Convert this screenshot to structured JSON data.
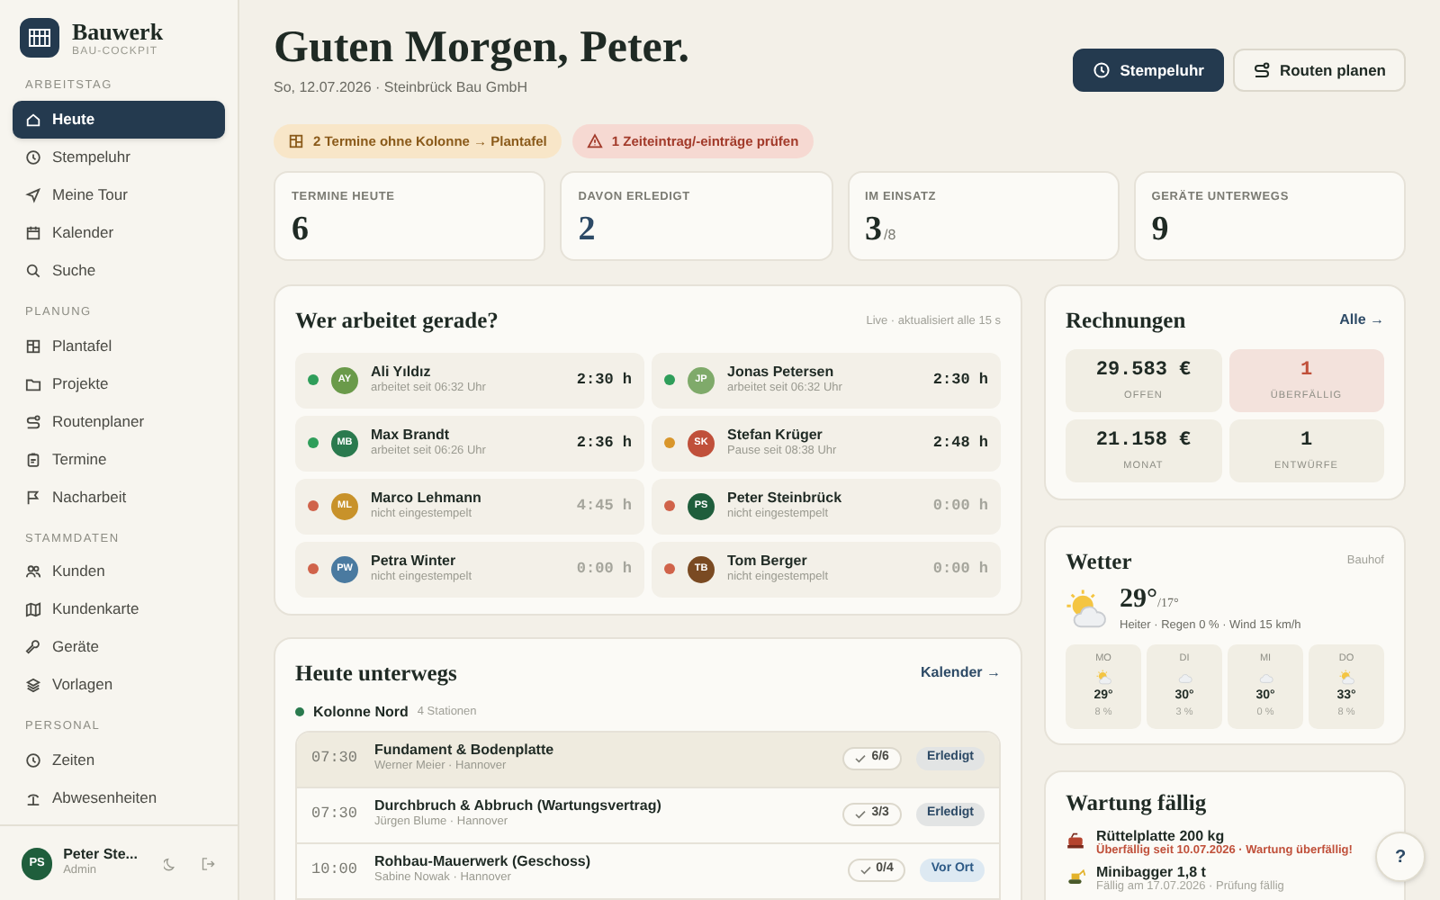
{
  "brand": {
    "name": "Bauwerk",
    "subtitle": "BAU-COCKPIT"
  },
  "sidebar": {
    "sections": [
      {
        "title": "ARBEITSTAG",
        "items": [
          {
            "label": "Heute",
            "selected": true
          },
          {
            "label": "Stempeluhr",
            "selected": false
          },
          {
            "label": "Meine Tour",
            "selected": false
          },
          {
            "label": "Kalender",
            "selected": false
          },
          {
            "label": "Suche",
            "selected": false
          }
        ]
      },
      {
        "title": "PLANUNG",
        "items": [
          {
            "label": "Plantafel",
            "selected": false
          },
          {
            "label": "Projekte",
            "selected": false
          },
          {
            "label": "Routenplaner",
            "selected": false
          },
          {
            "label": "Termine",
            "selected": false
          },
          {
            "label": "Nacharbeit",
            "selected": false
          }
        ]
      },
      {
        "title": "STAMMDATEN",
        "items": [
          {
            "label": "Kunden",
            "selected": false
          },
          {
            "label": "Kundenkarte",
            "selected": false
          },
          {
            "label": "Geräte",
            "selected": false
          },
          {
            "label": "Vorlagen",
            "selected": false
          }
        ]
      },
      {
        "title": "PERSONAL",
        "items": [
          {
            "label": "Zeiten",
            "selected": false
          },
          {
            "label": "Abwesenheiten",
            "selected": false
          }
        ]
      }
    ],
    "user": {
      "initials": "PS",
      "name": "Peter Ste...",
      "role": "Admin"
    }
  },
  "header": {
    "title": "Guten Morgen, Peter.",
    "subtitle": "So, 12.07.2026 · Steinbrück Bau GmbH",
    "buttons": [
      {
        "label": "Stempeluhr",
        "kind": "primary"
      },
      {
        "label": "Routen planen",
        "kind": "secondary"
      }
    ]
  },
  "alerts": [
    {
      "kind": "warning",
      "text": "2 Termine ohne Kolonne → Plantafel"
    },
    {
      "kind": "danger",
      "text": "1 Zeiteintrag/-einträge prüfen"
    }
  ],
  "stats": [
    {
      "label": "TERMINE HEUTE",
      "value": "6",
      "highlight": false
    },
    {
      "label": "DAVON ERLEDIGT",
      "value": "2",
      "highlight": true
    },
    {
      "label": "IM EINSATZ",
      "value": "3",
      "suffix": "/8",
      "highlight": false
    },
    {
      "label": "GERÄTE UNTERWEGS",
      "value": "9",
      "highlight": false
    }
  ],
  "workers": {
    "title": "Wer arbeitet gerade?",
    "note": "Live · aktualisiert alle 15 s",
    "items": [
      {
        "name": "Ali Yıldız",
        "detail": "arbeitet seit 06:32 Uhr",
        "time": "2:30 h",
        "clocked_in": true,
        "color": "#2f9e5a",
        "avatar": {
          "initials": "AY",
          "color": "#6a9a4a"
        }
      },
      {
        "name": "Jonas Petersen",
        "detail": "arbeitet seit 06:32 Uhr",
        "time": "2:30 h",
        "clocked_in": true,
        "color": "#2f9e5a",
        "avatar": {
          "initials": "JP",
          "color": "#7faa6a"
        }
      },
      {
        "name": "Max Brandt",
        "detail": "arbeitet seit 06:26 Uhr",
        "time": "2:36 h",
        "clocked_in": true,
        "color": "#2f9e5a",
        "avatar": {
          "initials": "MB",
          "color": "#2a7a4e"
        }
      },
      {
        "name": "Stefan Krüger",
        "detail": "Pause seit 08:38 Uhr",
        "time": "2:48 h",
        "clocked_in": true,
        "color": "#d9962b",
        "avatar": {
          "initials": "SK",
          "color": "#c0503a"
        }
      },
      {
        "name": "Marco Lehmann",
        "detail": "nicht eingestempelt",
        "time": "4:45 h",
        "clocked_in": false,
        "color": "#d0634a",
        "avatar": {
          "initials": "ML",
          "color": "#c8922a"
        }
      },
      {
        "name": "Peter Steinbrück",
        "detail": "nicht eingestempelt",
        "time": "0:00 h",
        "clocked_in": false,
        "color": "#d0634a",
        "avatar": {
          "initials": "PS",
          "color": "#1f5e3c"
        }
      },
      {
        "name": "Petra Winter",
        "detail": "nicht eingestempelt",
        "time": "0:00 h",
        "clocked_in": false,
        "color": "#d0634a",
        "avatar": {
          "initials": "PW",
          "color": "#4a7aa0"
        }
      },
      {
        "name": "Tom Berger",
        "detail": "nicht eingestempelt",
        "time": "0:00 h",
        "clocked_in": false,
        "color": "#d0634a",
        "avatar": {
          "initials": "TB",
          "color": "#7a4a22"
        }
      }
    ]
  },
  "tour": {
    "title": "Heute unterwegs",
    "link": "Kalender →",
    "group": {
      "name": "Kolonne Nord",
      "count": "4 Stationen",
      "color": "#2a7a4e"
    },
    "rows": [
      {
        "time": "07:30",
        "title": "Fundament & Bodenplatte",
        "detail": "Werner Meier · Hannover",
        "progress": "6/6",
        "status": "Erledigt",
        "kind": "done",
        "selected": true
      },
      {
        "time": "07:30",
        "title": "Durchbruch & Abbruch (Wartungsvertrag)",
        "detail": "Jürgen Blume · Hannover",
        "progress": "3/3",
        "status": "Erledigt",
        "kind": "done",
        "selected": false
      },
      {
        "time": "10:00",
        "title": "Rohbau-Mauerwerk (Geschoss)",
        "detail": "Sabine Nowak · Hannover",
        "progress": "0/4",
        "status": "Vor Ort",
        "kind": "onsite",
        "selected": false
      }
    ]
  },
  "invoices": {
    "title": "Rechnungen",
    "link": "Alle →",
    "tiles": [
      {
        "value": "29.583 €",
        "label": "OFFEN",
        "alert": false
      },
      {
        "value": "1",
        "label": "ÜBERFÄLLIG",
        "alert": true
      },
      {
        "value": "21.158 €",
        "label": "MONAT",
        "alert": false
      },
      {
        "value": "1",
        "label": "ENTWÜRFE",
        "alert": false
      }
    ]
  },
  "weather": {
    "title": "Wetter",
    "location": "Bauhof",
    "temp": "29°",
    "low": "/17°",
    "summary": "Heiter · Regen 0 % · Wind 15 km/h",
    "days": [
      {
        "day": "MO",
        "kind": "partly",
        "temp": "29°",
        "rain": "8 %"
      },
      {
        "day": "DI",
        "kind": "cloudy",
        "temp": "30°",
        "rain": "3 %"
      },
      {
        "day": "MI",
        "kind": "cloudy",
        "temp": "30°",
        "rain": "0 %"
      },
      {
        "day": "DO",
        "kind": "partly",
        "temp": "33°",
        "rain": "8 %"
      }
    ]
  },
  "maintenance": {
    "title": "Wartung fällig",
    "items": [
      {
        "name": "Rüttelplatte 200 kg",
        "detail": "Überfällig seit 10.07.2026 · Wartung überfällig!",
        "overdue": true,
        "kind": "compactor"
      },
      {
        "name": "Minibagger 1,8 t",
        "detail": "Fällig am 17.07.2026 · Prüfung fällig",
        "overdue": false,
        "kind": "excavator"
      }
    ]
  },
  "help": "?"
}
